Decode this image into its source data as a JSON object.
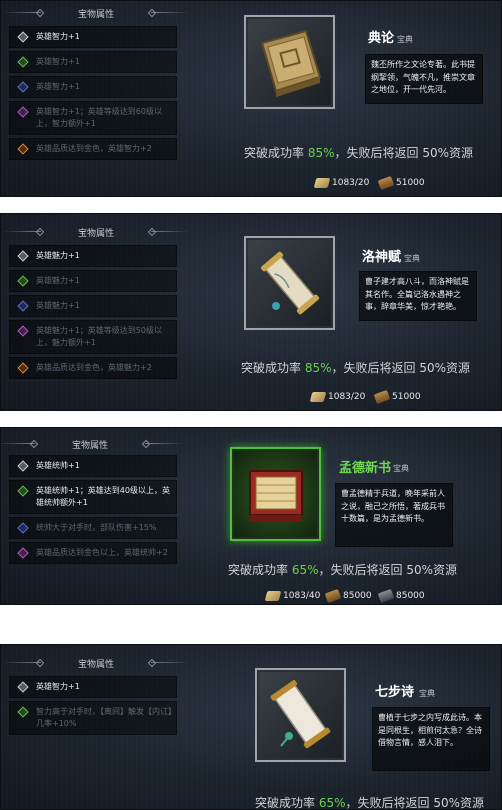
{
  "panels": [
    {
      "attr_title": "宝物属性",
      "attrs": [
        {
          "gem": "white-gem-icon",
          "text": "英雄智力+1",
          "active": true
        },
        {
          "gem": "green-gem-icon",
          "text": "英雄智力+1",
          "active": false
        },
        {
          "gem": "blue-gem-icon",
          "text": "英雄智力+1",
          "active": false
        },
        {
          "gem": "purple-gem-icon",
          "text": "英雄智力+1；英雄等级达到60级以上，智力额外+1",
          "active": false
        },
        {
          "gem": "orange-gem-icon",
          "text": "英雄品质达到金色，英雄智力+2",
          "active": false
        }
      ],
      "item_icon": "book-icon",
      "item_name": "典论",
      "item_type": "宝典",
      "description": "魏丕所作之文论专著。此书提纲挈领，气魄不凡，推崇文章之地位，开一代先河。",
      "rate_prefix": "突破成功率",
      "rate": "85%",
      "rate_suffix": "，失败后将返回 50%资源",
      "costs": [
        {
          "icon": "scroll-icon",
          "value": "1083/20"
        },
        {
          "icon": "wood-icon",
          "value": "51000"
        }
      ]
    },
    {
      "attr_title": "宝物属性",
      "attrs": [
        {
          "gem": "white-gem-icon",
          "text": "英雄魅力+1",
          "active": true
        },
        {
          "gem": "green-gem-icon",
          "text": "英雄魅力+1",
          "active": false
        },
        {
          "gem": "blue-gem-icon",
          "text": "英雄魅力+1",
          "active": false
        },
        {
          "gem": "purple-gem-icon",
          "text": "英雄魅力+1；英雄等级达到50级以上，魅力额外+1",
          "active": false
        },
        {
          "gem": "orange-gem-icon",
          "text": "英雄品质达到金色，英雄魅力+2",
          "active": false
        }
      ],
      "item_icon": "scroll-item-icon",
      "item_name": "洛神赋",
      "item_type": "宝典",
      "description": "曹子建才高八斗，而洛神赋是其名作。全篇记洛水遇神之事，辞章华美，惊才艳艳。",
      "rate_prefix": "突破成功率",
      "rate": "85%",
      "rate_suffix": "，失败后将返回 50%资源",
      "costs": [
        {
          "icon": "scroll-icon",
          "value": "1083/20"
        },
        {
          "icon": "wood-icon",
          "value": "51000"
        }
      ]
    },
    {
      "attr_title": "宝物属性",
      "attrs": [
        {
          "gem": "white-gem-icon",
          "text": "英雄统帅+1",
          "active": true
        },
        {
          "gem": "green-gem-icon",
          "text": "英雄统帅+1；英雄达到40级以上，英雄统帅额外+1",
          "active": true
        },
        {
          "gem": "blue-gem-icon",
          "text": "统帅大于对手时，部队伤害+15%",
          "active": false
        },
        {
          "gem": "purple-gem-icon",
          "text": "英雄品质达到金色以上，英雄统帅+2",
          "active": false
        }
      ],
      "item_icon": "red-book-icon",
      "item_name": "孟德新书",
      "item_type": "宝典",
      "description": "曹孟德精于兵道，晚年采前人之说，融己之所悟，著成兵书十数篇，是为孟德新书。",
      "rate_prefix": "突破成功率",
      "rate": "65%",
      "rate_suffix": "，失败后将返回 50%资源",
      "costs": [
        {
          "icon": "scroll-icon",
          "value": "1083/40"
        },
        {
          "icon": "wood-icon",
          "value": "85000"
        },
        {
          "icon": "iron-icon",
          "value": "85000"
        }
      ]
    },
    {
      "attr_title": "宝物属性",
      "attrs": [
        {
          "gem": "white-gem-icon",
          "text": "英雄智力+1",
          "active": true
        },
        {
          "gem": "green-gem-icon",
          "text": "智力高于对手时，【离间】触发【内讧】几率+10%",
          "active": false
        }
      ],
      "item_icon": "poem-scroll-icon",
      "item_name": "七步诗",
      "item_type": "宝典",
      "description": "曹植于七步之内写成此诗。本是同根生，相煎何太急？全诗借物言情，感人泪下。",
      "rate_prefix": "突破成功率",
      "rate": "65%",
      "rate_suffix": "，失败后将返回 50%资源",
      "costs": []
    }
  ]
}
